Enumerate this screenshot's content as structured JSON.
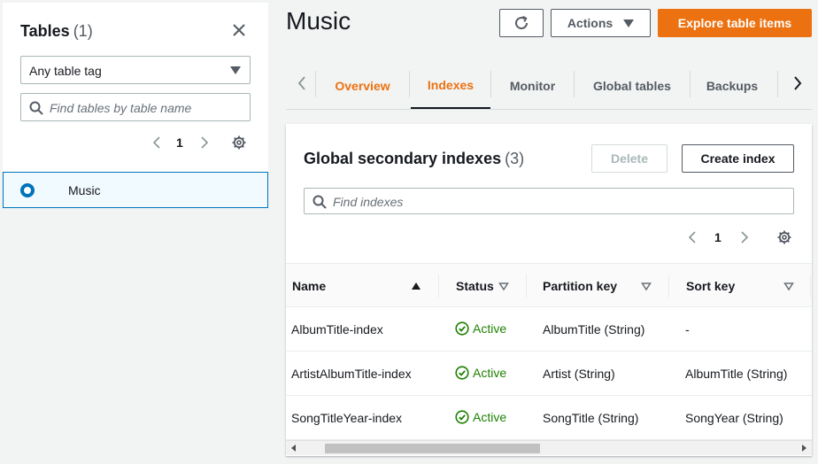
{
  "sidebar": {
    "title": "Tables",
    "count": "(1)",
    "tag_filter": "Any table tag",
    "search_placeholder": "Find tables by table name",
    "page": "1",
    "tables": [
      {
        "name": "Music",
        "selected": true
      }
    ]
  },
  "header": {
    "title": "Music",
    "actions_label": "Actions",
    "explore_label": "Explore table items"
  },
  "tabs": [
    {
      "label": "Overview"
    },
    {
      "label": "Indexes",
      "selected": true
    },
    {
      "label": "Monitor"
    },
    {
      "label": "Global tables"
    },
    {
      "label": "Backups"
    }
  ],
  "gsi": {
    "title": "Global secondary indexes",
    "count": "(3)",
    "delete_label": "Delete",
    "create_label": "Create index",
    "search_placeholder": "Find indexes",
    "page": "1",
    "columns": [
      "Name",
      "Status",
      "Partition key",
      "Sort key"
    ],
    "rows": [
      {
        "name": "AlbumTitle-index",
        "status": "Active",
        "partition_key": "AlbumTitle (String)",
        "sort_key": "-"
      },
      {
        "name": "ArtistAlbumTitle-index",
        "status": "Active",
        "partition_key": "Artist (String)",
        "sort_key": "AlbumTitle (String)"
      },
      {
        "name": "SongTitleYear-index",
        "status": "Active",
        "partition_key": "SongTitle (String)",
        "sort_key": "SongYear (String)"
      }
    ]
  },
  "colors": {
    "accent": "#ec7211",
    "link_blue": "#0073bb",
    "success": "#1d8102"
  }
}
